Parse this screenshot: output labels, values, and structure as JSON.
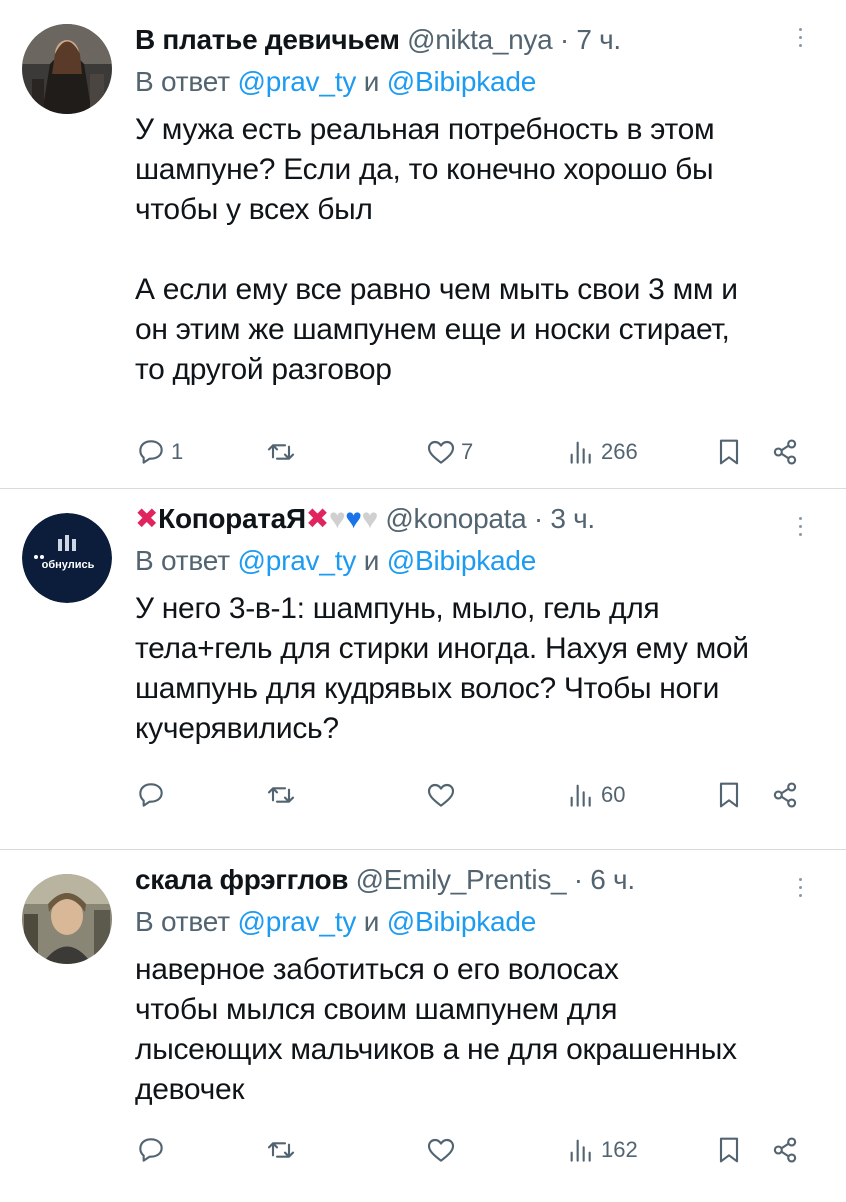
{
  "colors": {
    "link": "#1d9bf0",
    "muted": "#536471",
    "text": "#0f1419",
    "heart_blue": "#1a73e8",
    "cross_red": "#e0245e"
  },
  "tweets": [
    {
      "display_name": "В платье девичьем",
      "handle": "@nikta_nya",
      "dot": "·",
      "time": "7 ч.",
      "reply_prefix": "В ответ",
      "reply_mention_1": "@prav_ty",
      "reply_and": "и",
      "reply_mention_2": "@Bibipkade",
      "body": "У мужа есть реальная потребность в этом\nшампуне? Если да, то конечно хорошо бы\nчтобы у всех был\n\nА если ему все равно чем мыть свои 3 мм и\nон этим же шампунем еще и носки стирает,\nто другой разговор",
      "replies": "1",
      "retweets": "",
      "likes": "7",
      "views": "266"
    },
    {
      "display_name": "❌КопоратаЯ❌🤍💙🤍",
      "name_prefix_icon": "cross-mark",
      "name_text": "КопоратаЯ",
      "handle": "@konopata",
      "dot": "·",
      "time": "3 ч.",
      "reply_prefix": "В ответ",
      "reply_mention_1": "@prav_ty",
      "reply_and": "и",
      "reply_mention_2": "@Bibipkade",
      "avatar_text": "обнулись",
      "body": "У него 3-в-1: шампунь, мыло, гель для\nтела+гель для стирки иногда. Нахуя ему мой\nшампунь для кудрявых волос? Чтобы ноги\nкучерявились?",
      "replies": "",
      "retweets": "",
      "likes": "",
      "views": "60"
    },
    {
      "display_name": "скала фрэгглов",
      "handle": "@Emily_Prentis_",
      "dot": "·",
      "time": "6 ч.",
      "reply_prefix": "В ответ",
      "reply_mention_1": "@prav_ty",
      "reply_and": "и",
      "reply_mention_2": "@Bibipkade",
      "body": "наверное заботиться о его волосах\nчтобы мылся своим шампунем для\nлысеющих мальчиков а не для окрашенных\nдевочек",
      "replies": "",
      "retweets": "",
      "likes": "",
      "views": "162"
    }
  ]
}
